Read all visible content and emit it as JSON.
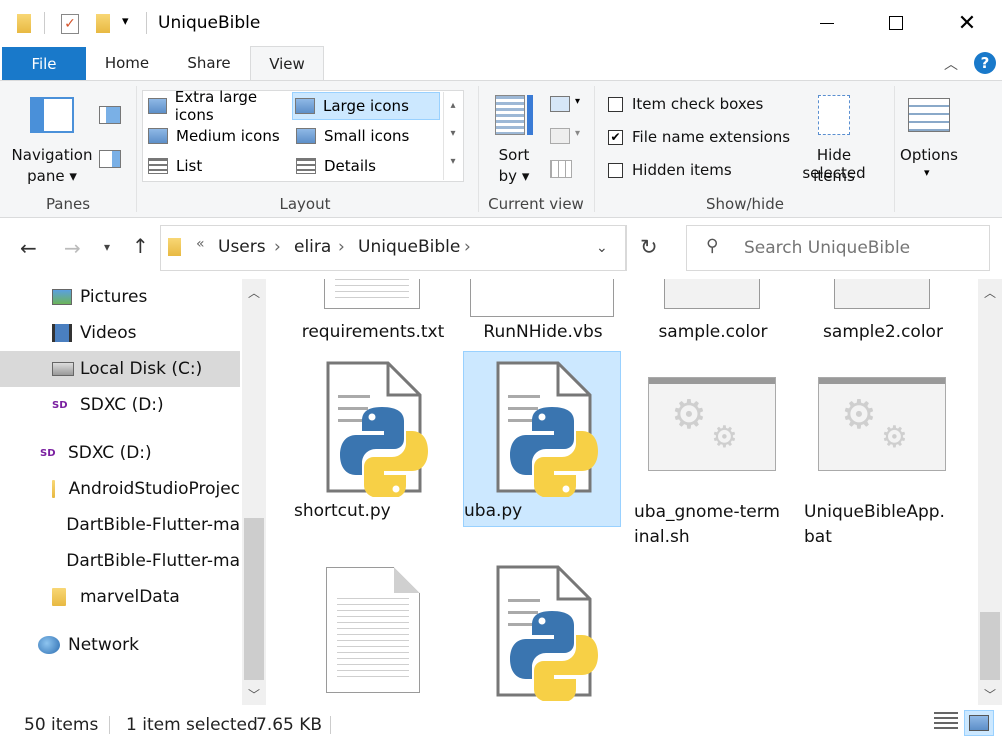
{
  "window": {
    "title": "UniqueBible"
  },
  "tabs": {
    "file": "File",
    "home": "Home",
    "share": "Share",
    "view": "View"
  },
  "ribbon": {
    "panes": {
      "nav_line1": "Navigation",
      "nav_line2": "pane",
      "label": "Panes"
    },
    "layout": {
      "items": [
        "Extra large icons",
        "Large icons",
        "Medium icons",
        "Small icons",
        "List",
        "Details"
      ],
      "selected": "Large icons",
      "label": "Layout"
    },
    "current_view": {
      "sort_line1": "Sort",
      "sort_line2": "by",
      "label": "Current view"
    },
    "show_hide": {
      "item_check_boxes": "Item check boxes",
      "file_name_extensions": "File name extensions",
      "hidden_items": "Hidden items",
      "hide_selected_line1": "Hide selected",
      "hide_selected_line2": "items",
      "label": "Show/hide",
      "checked": {
        "item_check_boxes": false,
        "file_name_extensions": true,
        "hidden_items": false
      }
    },
    "options": {
      "label": "Options"
    }
  },
  "address": {
    "overflow": "«",
    "crumbs": [
      "Users",
      "elira",
      "UniqueBible"
    ]
  },
  "search": {
    "placeholder": "Search UniqueBible"
  },
  "nav": {
    "items": [
      "Pictures",
      "Videos",
      "Local Disk (C:)",
      "SDXC (D:)",
      "SDXC (D:)",
      "AndroidStudioProjec",
      "DartBible-Flutter-ma",
      "DartBible-Flutter-ma",
      "marvelData",
      "Network"
    ]
  },
  "files": {
    "row1": [
      "requirements.txt",
      "RunNHide.vbs",
      "sample.color",
      "sample2.color"
    ],
    "shortcut": "shortcut.py",
    "uba": "uba.py",
    "gnome_line1": "uba_gnome-term",
    "gnome_line2": "inal.sh",
    "ubapp_line1": "UniqueBibleApp.",
    "ubapp_line2": "bat"
  },
  "status": {
    "count": "50 items",
    "selected": "1 item selected",
    "size": "7.65 KB"
  },
  "colors": {
    "accent": "#1979ca",
    "selection": "#cce8ff",
    "selection_border": "#99d1ff"
  }
}
